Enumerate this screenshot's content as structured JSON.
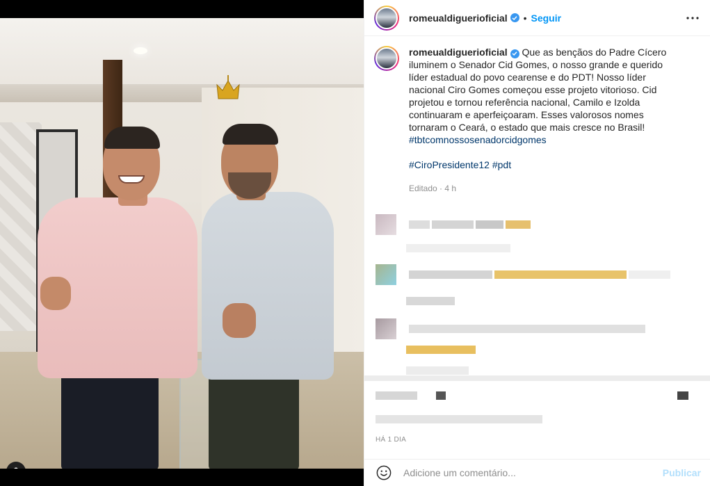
{
  "post": {
    "username": "romeualdiguerioficial",
    "follow_label": "Seguir",
    "more_icon": "more-horizontal-icon",
    "caption": {
      "username": "romeualdiguerioficial",
      "body": "Que as bençãos do Padre Cícero iluminem o Senador Cid Gomes, o nosso grande e querido líder estadual do povo cearense e do PDT! Nosso líder nacional Ciro Gomes começou esse projeto vitorioso. Cid projetou e tornou referência nacional, Camilo e Izolda continuaram e aperfeiçoaram. Esses valorosos nomes tornaram o Ceará, o estado que mais cresce no Brasil!",
      "hashtag_1": "#tbtcomnossosenadorcidgomes",
      "hashtag_2": "#CiroPresidente12",
      "hashtag_3": "#pdt",
      "edited": "Editado · 4 h"
    },
    "timestamp": "HÁ 1 DIA",
    "comment_placeholder": "Adicione um comentário...",
    "publish_label": "Publicar"
  },
  "colors": {
    "accent": "#0095f6",
    "hashtag": "#00376b",
    "muted": "#8e8e8e",
    "publish_disabled": "#b2dffc"
  }
}
